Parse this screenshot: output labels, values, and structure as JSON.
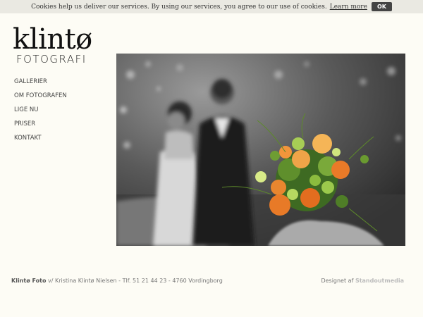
{
  "cookie": {
    "message": "Cookies help us deliver our services. By using our services, you agree to our use of cookies.",
    "learn_more": "Learn more",
    "ok": "OK"
  },
  "logo": {
    "line1": "klintø",
    "line2": "FOTOGRAFI"
  },
  "nav": {
    "items": [
      "GALLERIER",
      "OM FOTOGRAFEN",
      "LIGE NU",
      "PRISER",
      "KONTAKT"
    ]
  },
  "footer": {
    "company": "Klintø Foto",
    "info": " v/ Kristina Klintø Nielsen - Tlf. 51 21 44 23 - 4760 Vordingborg",
    "designed_by": "Designet af",
    "designer": "Standoutmedia"
  },
  "colors": {
    "background": "#fdfcf5",
    "cookie_bar": "#eae9e2",
    "ok_button": "#444444"
  }
}
